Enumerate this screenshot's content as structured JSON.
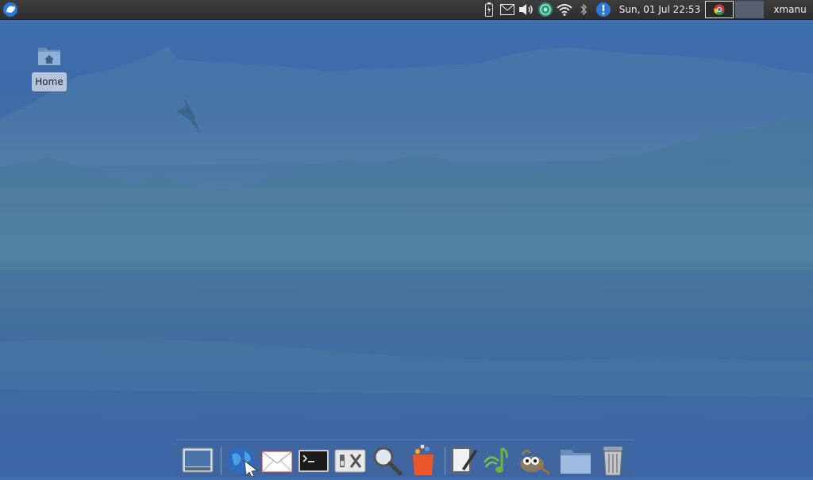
{
  "top_panel": {
    "clock": "Sun, 01 Jul  22:53",
    "username": "xmanu",
    "icons": [
      "whisker-menu-icon",
      "battery-icon",
      "mail-icon",
      "volume-icon",
      "network-icon",
      "wifi-icon",
      "bluetooth-icon",
      "notification-icon"
    ],
    "windows": [
      "chrome-window-button",
      "empty-window-button"
    ]
  },
  "desktop": {
    "home_label": "Home"
  },
  "dock": {
    "items": [
      "show-desktop",
      "web-browser",
      "mail-client",
      "terminal",
      "settings",
      "search",
      "software-center",
      "text-editor",
      "music-player",
      "gimp",
      "file-manager",
      "trash"
    ]
  },
  "colors": {
    "panel": "#2e2e2e",
    "wallpaper": "#3f6fb0"
  }
}
